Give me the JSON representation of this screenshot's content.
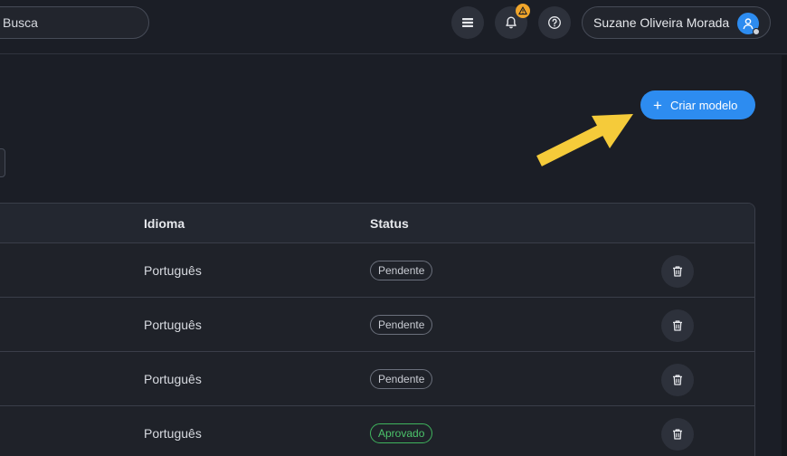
{
  "header": {
    "search_label": "Busca",
    "user_name": "Suzane Oliveira Morada",
    "icons": [
      "menu-icon",
      "bell-icon",
      "help-icon",
      "user-icon"
    ],
    "warning_badge": "⚠"
  },
  "toolbar": {
    "create_label": "Criar modelo",
    "create_icon": "+"
  },
  "table": {
    "columns": [
      "Idioma",
      "Status"
    ],
    "rows": [
      {
        "language": "Português",
        "status": "Pendente"
      },
      {
        "language": "Português",
        "status": "Pendente"
      },
      {
        "language": "Português",
        "status": "Pendente"
      },
      {
        "language": "Português",
        "status": "Aprovado"
      }
    ]
  },
  "colors": {
    "accent": "#2d8cf0",
    "approved": "#4cc46b",
    "warning": "#f0a52b",
    "annotation_arrow": "#f5cb3a"
  }
}
